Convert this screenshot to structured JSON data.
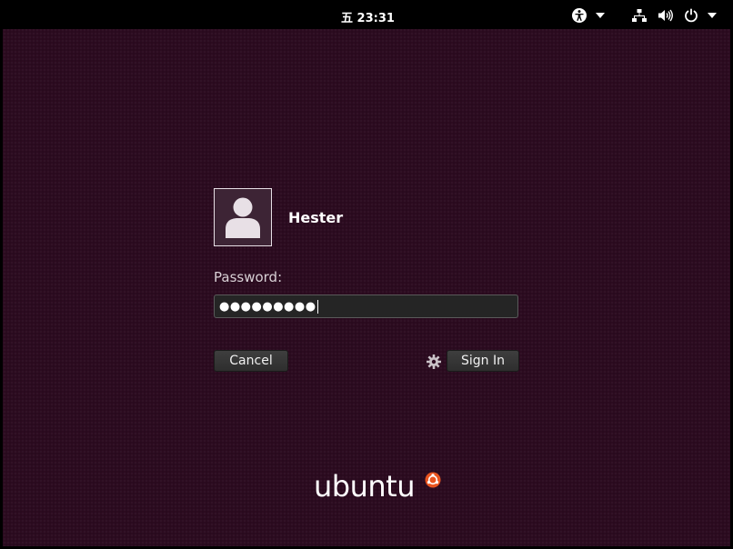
{
  "topbar": {
    "clock": "五 23:31",
    "icons": [
      "accessibility-icon",
      "chevron-down-icon",
      "network-icon",
      "volume-icon",
      "power-icon",
      "chevron-down-icon"
    ]
  },
  "login": {
    "username": "Hester",
    "password_label": "Password:",
    "password_mask": "●●●●●●●●●",
    "cancel_label": "Cancel",
    "signin_label": "Sign In",
    "session_icon": "gear-icon"
  },
  "branding": {
    "logo_text": "ubuntu",
    "logo_mark": "ubuntu-circle-of-friends-icon"
  },
  "colors": {
    "background": "#2c0b20",
    "topbar": "#000000",
    "accent": "#e95420"
  }
}
